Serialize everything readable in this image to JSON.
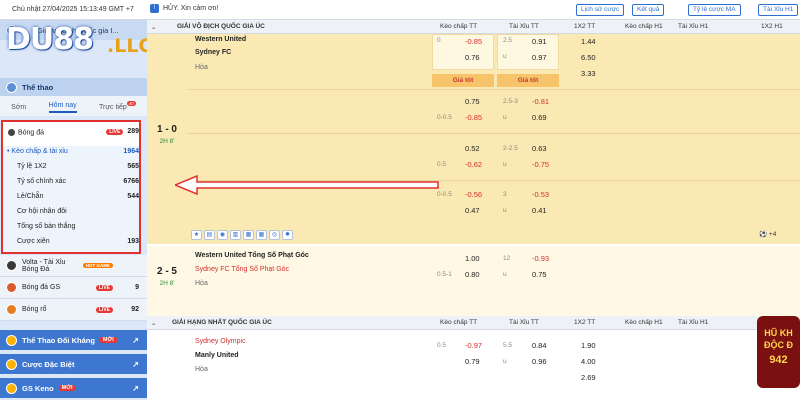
{
  "topbar": {
    "date": "Chủ nhật 27/04/2025 15:13:49 GMT +7",
    "notice": "HỦY. Xin cảm ơn!",
    "buttons": [
      "Lịch sử cược",
      "Kết quả",
      "Tỷ lệ cược MA",
      "Tài Xỉu H1"
    ]
  },
  "sidebar": {
    "logo": "DU88",
    "logo_suffix": ".LLC",
    "top_item": "Giải vô địch Quốc gia I...",
    "sports_title": "Thể thao",
    "tabs": [
      {
        "label": "Sớm"
      },
      {
        "label": "Hôm nay"
      },
      {
        "label": "Trực tiếp",
        "badge": "40"
      }
    ],
    "soccer": {
      "title": "Bóng đá",
      "live": "LIVE",
      "count": "289",
      "subitems": [
        {
          "label": "Kèo chấp & tài xỉu",
          "count": "1964"
        },
        {
          "label": "Tỷ lệ 1X2",
          "count": "565"
        },
        {
          "label": "Tỷ số chính xác",
          "count": "6766"
        },
        {
          "label": "Lẻ/Chẵn",
          "count": "544"
        },
        {
          "label": "Cơ hội nhân đôi",
          "count": ""
        },
        {
          "label": "Tổng số bàn thắng",
          "count": ""
        },
        {
          "label": "Cược xiên",
          "count": "193"
        }
      ]
    },
    "others": [
      {
        "label": "Volta - Tài Xỉu Bóng Đá",
        "tag": "HOT GAME",
        "count": ""
      },
      {
        "label": "Bóng đá GS",
        "tag": "LIVE",
        "count": "9"
      },
      {
        "label": "Bóng rổ",
        "tag": "LIVE",
        "count": "92"
      }
    ],
    "blue_items": [
      {
        "label": "Thể Thao Đối Kháng",
        "tag": "MỚI"
      },
      {
        "label": "Cược Đặc Biệt",
        "tag": ""
      },
      {
        "label": "GS Keno",
        "tag": "MỚI"
      }
    ]
  },
  "main": {
    "columns": [
      "Kèo chấp TT",
      "Tài Xỉu TT",
      "1X2 TT",
      "Kèo chấp H1",
      "Tài Xỉu H1",
      "1X2 H1"
    ],
    "league1": "GIẢI VÔ ĐỊCH QUỐC GIA ÚC",
    "match1": {
      "home": "Western United",
      "away": "Sydney FC",
      "draw": "Hòa",
      "score": "1 - 0",
      "period": "2H 8'",
      "rows": [
        {
          "hc_line": "0",
          "hc_odd": "-0.85",
          "ou_line": "2.5",
          "ou_odd": "0.91",
          "x12": "1.44"
        },
        {
          "hc_line": "",
          "hc_odd": "0.76",
          "ou_line": "u",
          "ou_odd": "0.97",
          "x12": "6.50"
        },
        {
          "x12": "3.33"
        }
      ],
      "giatot": "Giá tốt",
      "more": [
        {
          "hc_line": "",
          "hc_odd": "0.75",
          "ou_line": "2.5-3",
          "ou_odd": "-0.81"
        },
        {
          "hc_line": "0-0.5",
          "hc_odd": "-0.85",
          "ou_line": "u",
          "ou_odd": "0.69"
        },
        {
          "hc_line": "",
          "hc_odd": "0.52",
          "ou_line": "2-2.5",
          "ou_odd": "0.63"
        },
        {
          "hc_line": "0.5",
          "hc_odd": "-0.62",
          "ou_line": "u",
          "ou_odd": "-0.75"
        },
        {
          "hc_line": "0-0.5",
          "hc_odd": "-0.56",
          "ou_line": "3",
          "ou_odd": "-0.53"
        },
        {
          "hc_line": "",
          "hc_odd": "0.47",
          "ou_line": "u",
          "ou_odd": "0.41"
        }
      ],
      "more_count": "+4"
    },
    "match2": {
      "home": "Western United Tổng Số Phạt Góc",
      "away": "Sydney FC Tổng Số Phạt Góc",
      "draw": "Hòa",
      "score": "2 - 5",
      "period": "2H 8'",
      "rows": [
        {
          "hc_line": "",
          "hc_odd": "1.00",
          "ou_line": "12",
          "ou_odd": "-0.93"
        },
        {
          "hc_line": "0.5-1",
          "hc_odd": "0.80",
          "ou_line": "u",
          "ou_odd": "0.75"
        }
      ]
    },
    "league2": "GIẢI HẠNG NHẤT QUỐC GIA ÚC",
    "match3": {
      "home": "Sydney Olympic",
      "away": "Manly United",
      "draw": "Hòa",
      "rows": [
        {
          "hc_line": "0.5",
          "hc_odd": "-0.97",
          "ou_line": "5.5",
          "ou_odd": "0.84",
          "x12": "1.90"
        },
        {
          "hc_line": "",
          "hc_odd": "0.79",
          "ou_line": "u",
          "ou_odd": "0.96",
          "x12": "4.00"
        },
        {
          "x12": "2.69"
        }
      ]
    }
  },
  "promo": {
    "line1": "HŨ KH",
    "line2": "ĐỘC Đ",
    "line3": "942"
  },
  "colors": {
    "accent": "#2f6fd1",
    "highlight": "#fbe9b4",
    "red_frame": "#e0312f",
    "negative": "#d32f2f"
  }
}
